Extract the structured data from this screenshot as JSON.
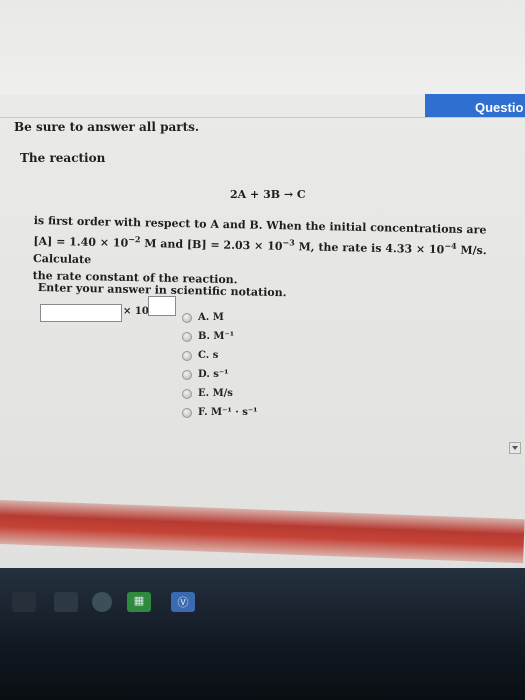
{
  "header": {
    "tab_label": "Questio"
  },
  "intro": "Be sure to answer all parts.",
  "lead": "The reaction",
  "equation": "2A + 3B → C",
  "problem": {
    "line1": "is first order with respect to A and B. When the initial concentrations are",
    "line2_a": "[A] = 1.40 × 10",
    "exp_a": "−2",
    "line2_b": " M and [B] = 2.03 × 10",
    "exp_b": "−3",
    "line2_c": " M, the rate is 4.33 × 10",
    "exp_c": "−4",
    "line2_d": " M/s. Calculate",
    "line3": "the rate constant of the reaction."
  },
  "instruction": "Enter your answer in scientific notation.",
  "answer": {
    "value": "",
    "times_ten": "× 10",
    "exponent": ""
  },
  "options": [
    {
      "label": "A. M"
    },
    {
      "label": "B. M⁻¹"
    },
    {
      "label": "C. s"
    },
    {
      "label": "D. s⁻¹"
    },
    {
      "label": "E. M/s"
    },
    {
      "label": "F. M⁻¹ · s⁻¹"
    }
  ],
  "taskbar": {
    "icons": [
      "window-icon",
      "app-icon",
      "browser-icon",
      "spreadsheet-icon",
      "skype-icon"
    ]
  },
  "colors": {
    "accent": "#2e6fd0",
    "divider": "#c0372d"
  }
}
